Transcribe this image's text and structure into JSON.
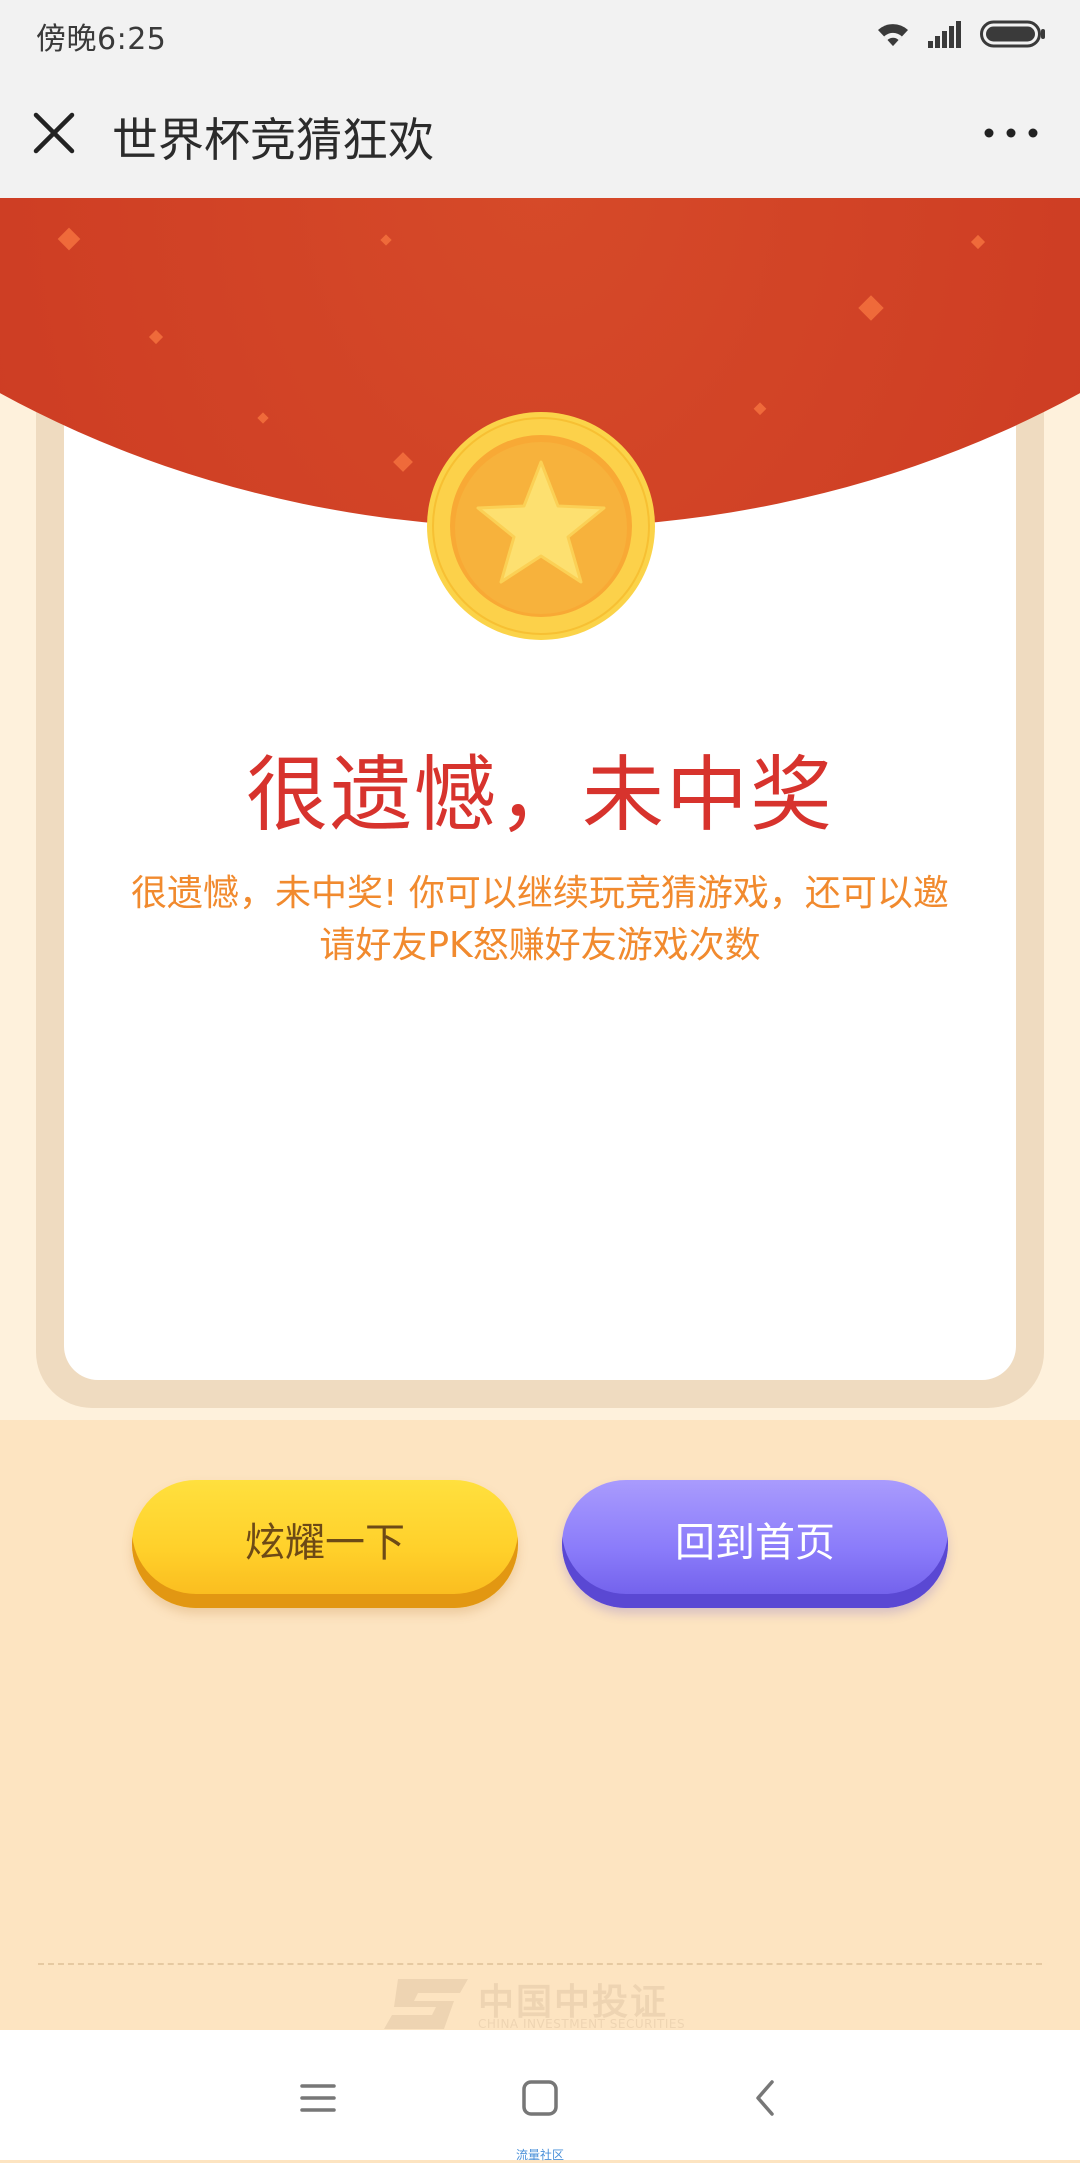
{
  "status_bar": {
    "time": "傍晚6:25",
    "icons": [
      "wifi-icon",
      "signal-icon",
      "battery-icon"
    ]
  },
  "header": {
    "title": "世界杯竞猜狂欢",
    "close_icon": "close-icon",
    "more_icon": "more-dots-icon"
  },
  "result": {
    "title": "很遗憾，未中奖",
    "description": "很遗憾，未中奖! 你可以继续玩竞猜游戏，还可以邀请好友PK怒赚好友游戏次数",
    "icon": "star-coin-icon"
  },
  "buttons": {
    "share_label": "炫耀一下",
    "home_label": "回到首页"
  },
  "footer": {
    "brand_cn": "中国中投证券",
    "brand_en": "CHINA INVESTMENT SECURITIES"
  },
  "bottom_nav": {
    "items": [
      "menu-icon",
      "home-icon",
      "back-icon"
    ],
    "watermark": "流量社区"
  },
  "colors": {
    "header_bg": "#f2f2f2",
    "banner_red": "#cd3c23",
    "title_red": "#d7332d",
    "desc_orange": "#f18a2e",
    "share_yellow": "#ffd02a",
    "home_purple": "#8a7bfa",
    "page_bg": "#fde4c1"
  }
}
